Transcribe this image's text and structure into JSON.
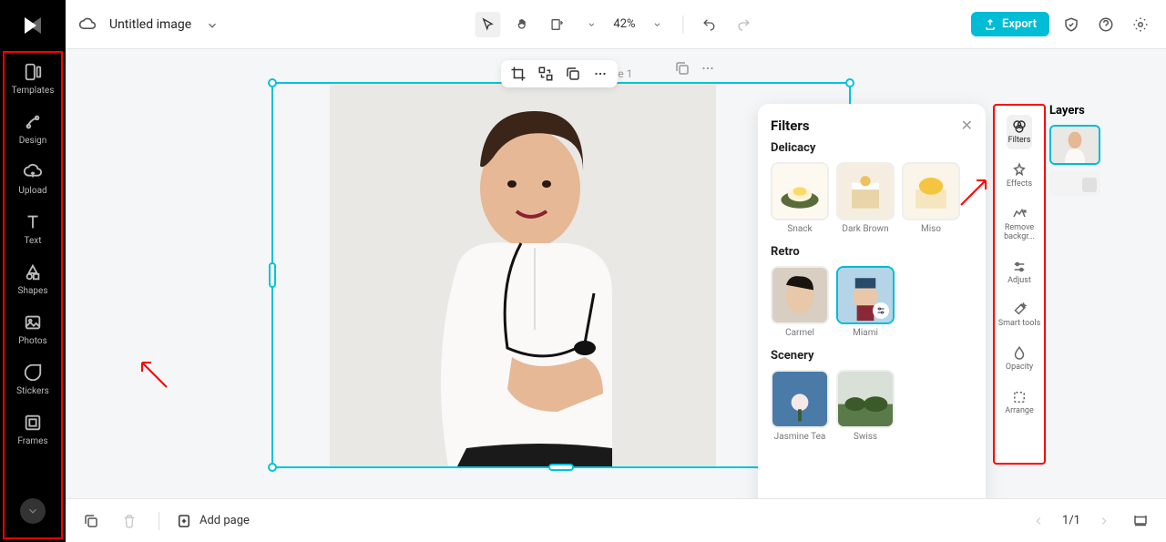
{
  "app": {
    "title": "Untitled image",
    "page_label": "Page 1",
    "zoom": "42%"
  },
  "export_label": "Export",
  "sidebar": {
    "items": [
      {
        "label": "Templates"
      },
      {
        "label": "Design"
      },
      {
        "label": "Upload"
      },
      {
        "label": "Text"
      },
      {
        "label": "Shapes"
      },
      {
        "label": "Photos"
      },
      {
        "label": "Stickers"
      },
      {
        "label": "Frames"
      }
    ]
  },
  "filters": {
    "title": "Filters",
    "categories": [
      {
        "name": "Delicacy",
        "items": [
          {
            "label": "Snack"
          },
          {
            "label": "Dark Brown"
          },
          {
            "label": "Miso"
          }
        ]
      },
      {
        "name": "Retro",
        "items": [
          {
            "label": "Carmel"
          },
          {
            "label": "Miami",
            "selected": true
          }
        ]
      },
      {
        "name": "Scenery",
        "items": [
          {
            "label": "Jasmine Tea"
          },
          {
            "label": "Swiss"
          }
        ]
      }
    ]
  },
  "right_rail": {
    "items": [
      {
        "label": "Filters",
        "active": true
      },
      {
        "label": "Effects"
      },
      {
        "label": "Remove backgr..."
      },
      {
        "label": "Adjust"
      },
      {
        "label": "Smart tools"
      },
      {
        "label": "Opacity"
      },
      {
        "label": "Arrange"
      }
    ]
  },
  "layers": {
    "title": "Layers"
  },
  "bottom": {
    "add_page": "Add page",
    "pagination": "1/1"
  }
}
